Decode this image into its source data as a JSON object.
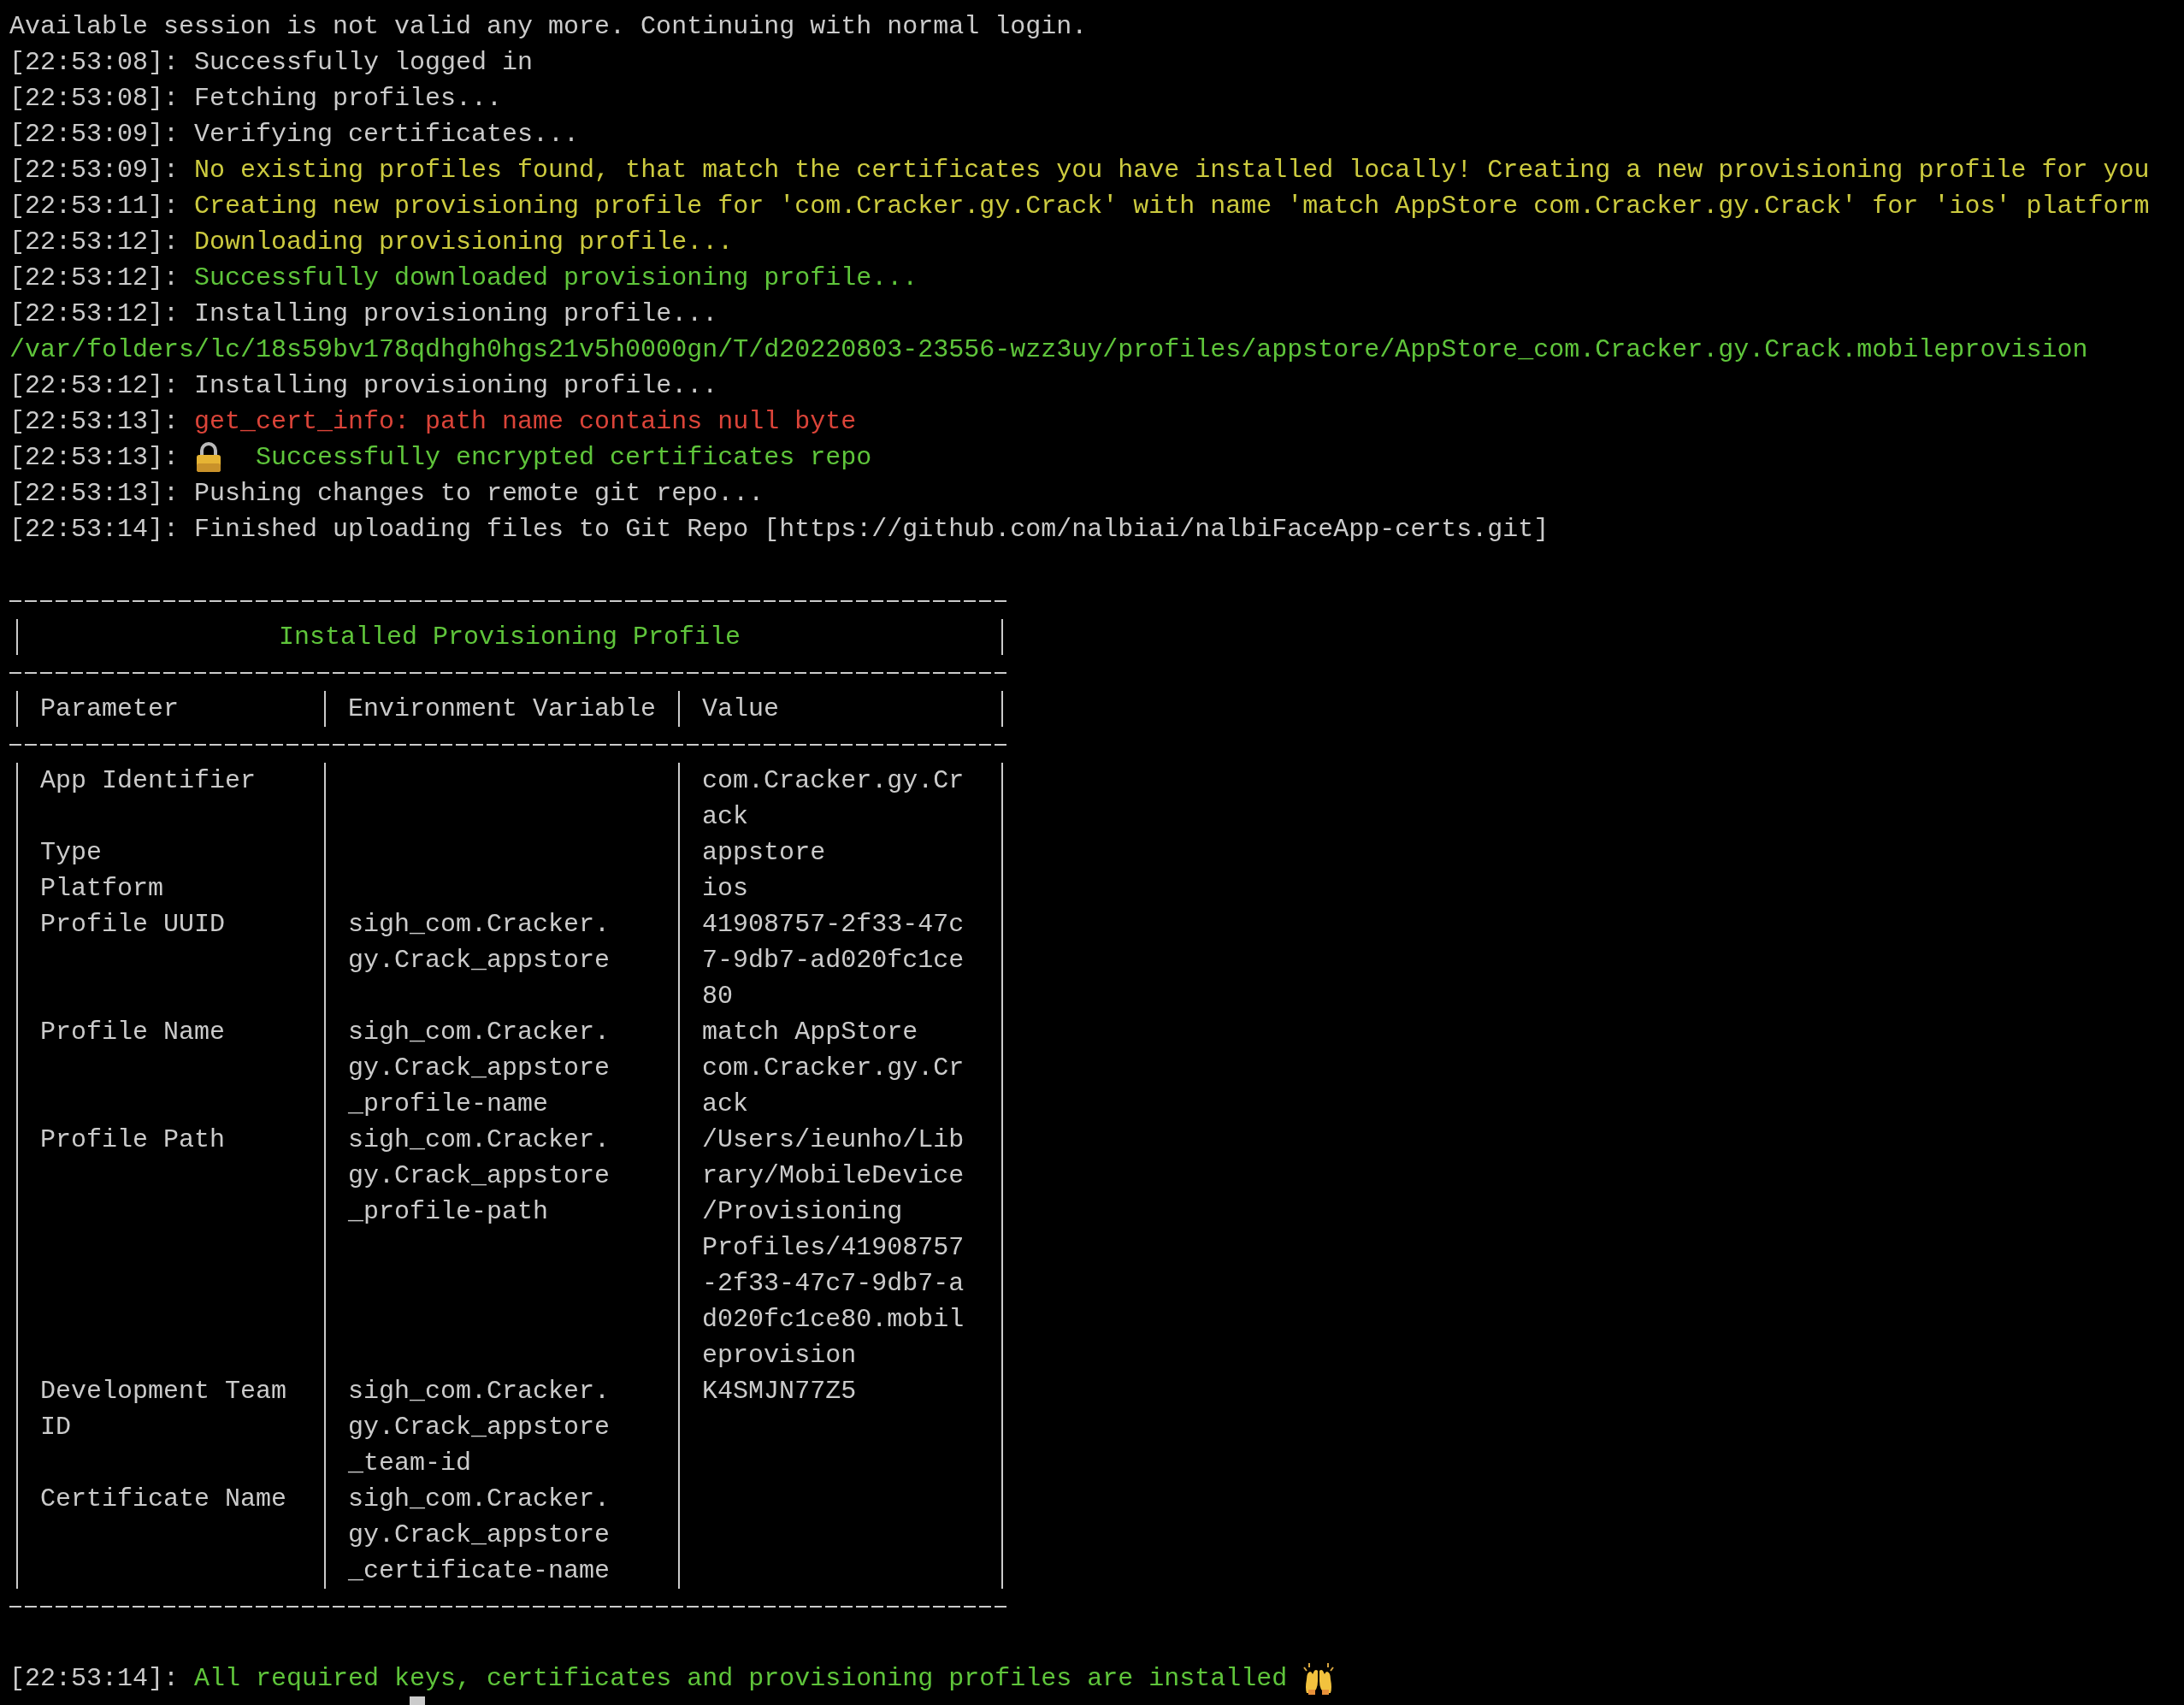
{
  "log_before": [
    {
      "text": "Available session is not valid any more. Continuing with normal login.",
      "kind": "info"
    },
    {
      "time": "[22:53:08]:",
      "text": "Successfully logged in",
      "kind": "info"
    },
    {
      "time": "[22:53:08]:",
      "text": "Fetching profiles...",
      "kind": "info"
    },
    {
      "time": "[22:53:09]:",
      "text": "Verifying certificates...",
      "kind": "info"
    },
    {
      "time": "[22:53:09]:",
      "text": "No existing profiles found, that match the certificates you have installed locally! Creating a new provisioning profile for you",
      "kind": "warning"
    },
    {
      "time": "[22:53:11]:",
      "text": "Creating new provisioning profile for 'com.Cracker.gy.Crack' with name 'match AppStore com.Cracker.gy.Crack' for 'ios' platform",
      "kind": "warning"
    },
    {
      "time": "[22:53:12]:",
      "text": "Downloading provisioning profile...",
      "kind": "warning"
    },
    {
      "time": "[22:53:12]:",
      "text": "Successfully downloaded provisioning profile...",
      "kind": "success"
    },
    {
      "time": "[22:53:12]:",
      "text": "Installing provisioning profile...",
      "kind": "info"
    },
    {
      "text": "/var/folders/lc/18s59bv178qdhgh0hgs21v5h0000gn/T/d20220803-23556-wzz3uy/profiles/appstore/AppStore_com.Cracker.gy.Crack.mobileprovision",
      "kind": "success"
    },
    {
      "time": "[22:53:12]:",
      "text": "Installing provisioning profile...",
      "kind": "info"
    },
    {
      "time": "[22:53:13]:",
      "text": "get_cert_info: path name contains null byte",
      "kind": "error"
    },
    {
      "time": "[22:53:13]:",
      "text": "Successfully encrypted certificates repo",
      "kind": "success",
      "lock_icon": true
    },
    {
      "time": "[22:53:13]:",
      "text": "Pushing changes to remote git repo...",
      "kind": "info"
    },
    {
      "time": "[22:53:14]:",
      "text": "Finished uploading files to Git Repo [https://github.com/nalbiai/nalbiFaceApp-certs.git]",
      "kind": "info"
    }
  ],
  "table": {
    "title": "Installed Provisioning Profile",
    "columns": [
      "Parameter",
      "Environment Variable",
      "Value"
    ],
    "rows": [
      {
        "parameter": "App Identifier",
        "value": "com.Cracker.gy.Cr\nack"
      },
      {
        "parameter": "Type",
        "value": "appstore"
      },
      {
        "parameter": "Platform",
        "value": "ios"
      },
      {
        "parameter": "Profile UUID",
        "environment_variable": "sigh_com.Cracker.\ngy.Crack_appstore",
        "value": "41908757-2f33-47c\n7-9db7-ad020fc1ce\n80"
      },
      {
        "parameter": "Profile Name",
        "environment_variable": "sigh_com.Cracker.\ngy.Crack_appstore\n_profile-name",
        "value": "match AppStore\ncom.Cracker.gy.Cr\nack"
      },
      {
        "parameter": "Profile Path",
        "environment_variable": "sigh_com.Cracker.\ngy.Crack_appstore\n_profile-path",
        "value": "/Users/ieunho/Lib\nrary/MobileDevice\n/Provisioning\nProfiles/41908757\n-2f33-47c7-9db7-a\nd020fc1ce80.mobil\neprovision"
      },
      {
        "parameter": "Development Team\nID",
        "environment_variable": "sigh_com.Cracker.\ngy.Crack_appstore\n_team-id",
        "value": "K4SMJN77Z5"
      },
      {
        "parameter": "Certificate Name",
        "environment_variable": "sigh_com.Cracker.\ngy.Crack_appstore\n_certificate-name"
      }
    ]
  },
  "log_after": [
    {
      "time": "[22:53:14]:",
      "text": "All required keys, certificates and provisioning profiles are installed",
      "kind": "success",
      "raised_hands_icon": true
    }
  ],
  "cursor": {
    "visible": true
  }
}
